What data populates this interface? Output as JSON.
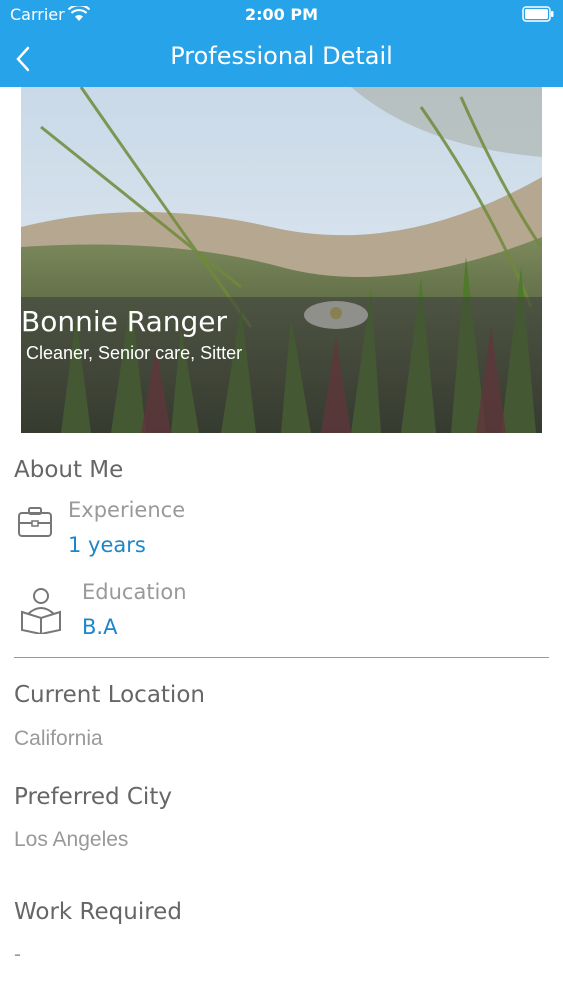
{
  "status": {
    "carrier": "Carrier",
    "time": "2:00 PM"
  },
  "nav": {
    "title": "Professional Detail"
  },
  "profile": {
    "name": "Bonnie Ranger",
    "roles": "Cleaner, Senior care, Sitter"
  },
  "about": {
    "title": "About Me",
    "experience_label": "Experience",
    "experience_value": "1 years",
    "education_label": "Education",
    "education_value": "B.A"
  },
  "location": {
    "title": "Current Location",
    "value": "California"
  },
  "preferred": {
    "title": "Preferred City",
    "value": "Los Angeles"
  },
  "work": {
    "title": "Work Required",
    "value": "-"
  },
  "colors": {
    "accent": "#27a3ea",
    "value_blue": "#1b86c9"
  }
}
